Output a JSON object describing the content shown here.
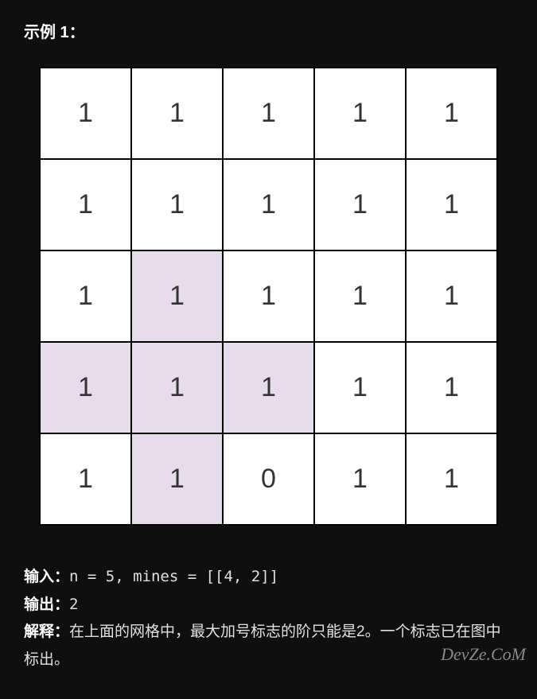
{
  "heading": "示例 1：",
  "grid": {
    "size": 5,
    "cells": [
      [
        {
          "v": "1",
          "hl": false
        },
        {
          "v": "1",
          "hl": false
        },
        {
          "v": "1",
          "hl": false
        },
        {
          "v": "1",
          "hl": false
        },
        {
          "v": "1",
          "hl": false
        }
      ],
      [
        {
          "v": "1",
          "hl": false
        },
        {
          "v": "1",
          "hl": false
        },
        {
          "v": "1",
          "hl": false
        },
        {
          "v": "1",
          "hl": false
        },
        {
          "v": "1",
          "hl": false
        }
      ],
      [
        {
          "v": "1",
          "hl": false
        },
        {
          "v": "1",
          "hl": true
        },
        {
          "v": "1",
          "hl": false
        },
        {
          "v": "1",
          "hl": false
        },
        {
          "v": "1",
          "hl": false
        }
      ],
      [
        {
          "v": "1",
          "hl": true
        },
        {
          "v": "1",
          "hl": true
        },
        {
          "v": "1",
          "hl": true
        },
        {
          "v": "1",
          "hl": false
        },
        {
          "v": "1",
          "hl": false
        }
      ],
      [
        {
          "v": "1",
          "hl": false
        },
        {
          "v": "1",
          "hl": true
        },
        {
          "v": "0",
          "hl": false
        },
        {
          "v": "1",
          "hl": false
        },
        {
          "v": "1",
          "hl": false
        }
      ]
    ]
  },
  "io": {
    "input_label": "输入：",
    "input_value": "n = 5, mines = [[4, 2]]",
    "output_label": "输出：",
    "output_value": "2",
    "explain_label": "解释：",
    "explain_text": "在上面的网格中，最大加号标志的阶只能是2。一个标志已在图中标出。"
  },
  "watermark": {
    "main": "DevZe.CoM",
    "sub": ""
  }
}
